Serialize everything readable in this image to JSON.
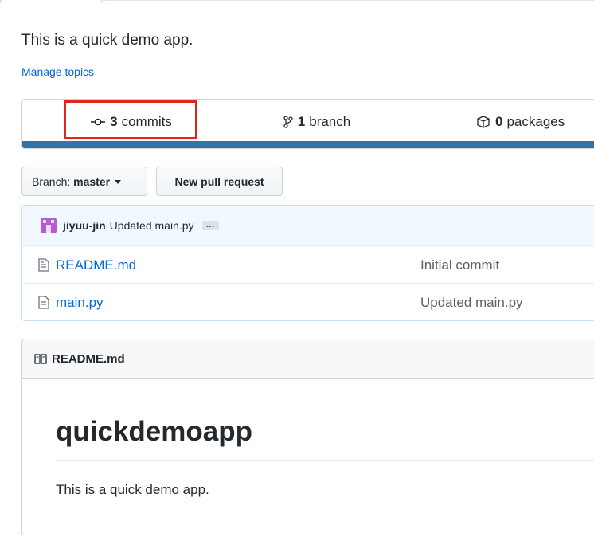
{
  "repo": {
    "description": "This is a quick demo app.",
    "manage_topics": "Manage topics"
  },
  "summary": {
    "commits": {
      "count": "3",
      "label": "commits"
    },
    "branches": {
      "count": "1",
      "label": "branch"
    },
    "packages": {
      "count": "0",
      "label": "packages"
    },
    "language_bar_color": "#3572a5",
    "highlight_color": "#e5241c"
  },
  "toolbar": {
    "branch_prefix": "Branch:",
    "branch_name": "master",
    "new_pr_label": "New pull request"
  },
  "latest_commit": {
    "author": "jiyuu-jin",
    "message": "Updated main.py",
    "ellipsis": "…"
  },
  "files": [
    {
      "name": "README.md",
      "message": "Initial commit"
    },
    {
      "name": "main.py",
      "message": "Updated main.py"
    }
  ],
  "readme": {
    "header": "README.md",
    "title": "quickdemoapp",
    "body": "This is a quick demo app."
  }
}
